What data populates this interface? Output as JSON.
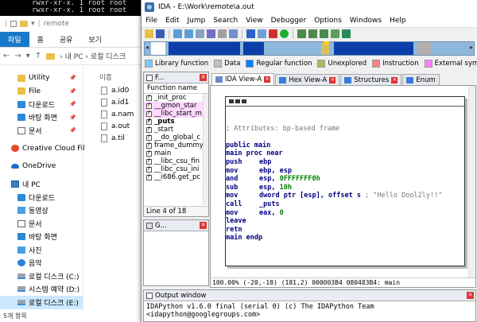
{
  "terminal": {
    "lines": [
      "rwxr-xr-x. 1 root root",
      "rwxr-xr-x. 1 root root"
    ]
  },
  "explorer": {
    "title": "remote",
    "ribbon_tabs": [
      "파일",
      "홈",
      "공유",
      "보기"
    ],
    "address": "› 내 PC › 로컬 디스크",
    "column_header": "이름",
    "nav": {
      "quick": [
        {
          "label": "Utility",
          "icon": "folder-icon"
        },
        {
          "label": "File",
          "icon": "folder-icon"
        },
        {
          "label": "다운로드",
          "icon": "download-icon"
        },
        {
          "label": "바탕 화면",
          "icon": "desktop-icon"
        },
        {
          "label": "문서",
          "icon": "document-icon"
        }
      ],
      "creative": "Creative Cloud Fil",
      "onedrive": "OneDrive",
      "this_pc": "내 PC",
      "pc_items": [
        {
          "label": "다운로드",
          "icon": "download-icon"
        },
        {
          "label": "동영상",
          "icon": "video-icon"
        },
        {
          "label": "문서",
          "icon": "document-icon"
        },
        {
          "label": "바탕 화면",
          "icon": "desktop-icon"
        },
        {
          "label": "사진",
          "icon": "picture-icon"
        },
        {
          "label": "음악",
          "icon": "music-icon"
        },
        {
          "label": "로컬 디스크 (C:)",
          "icon": "drive-icon"
        },
        {
          "label": "시스템 예약 (D:)",
          "icon": "drive-icon"
        },
        {
          "label": "로컬 디스크 (E:)",
          "icon": "drive-icon"
        }
      ]
    },
    "files": [
      "a.id0",
      "a.id1",
      "a.nam",
      "a.out",
      "a.til"
    ],
    "status": "5개 항목"
  },
  "ida": {
    "title": "IDA - E:\\Work\\remote\\a.out",
    "menus": [
      "File",
      "Edit",
      "Jump",
      "Search",
      "View",
      "Debugger",
      "Options",
      "Windows",
      "Help"
    ],
    "legend": [
      {
        "label": "Library function",
        "color": "#80c8ff"
      },
      {
        "label": "Data",
        "color": "#c0c0c0"
      },
      {
        "label": "Regular function",
        "color": "#0080ff"
      },
      {
        "label": "Unexplored",
        "color": "#b4b464"
      },
      {
        "label": "Instruction",
        "color": "#ff8080"
      },
      {
        "label": "External symbol",
        "color": "#ff80ff"
      }
    ],
    "function_pane": {
      "tab_label": "F...",
      "header": "Function name",
      "functions": [
        {
          "name": "_init_proc",
          "style": "normal"
        },
        {
          "name": "__gmon_star",
          "style": "hl"
        },
        {
          "name": "__libc_start_m",
          "style": "hl"
        },
        {
          "name": "_puts",
          "style": "bold"
        },
        {
          "name": "_start",
          "style": "normal"
        },
        {
          "name": "__do_global_c",
          "style": "normal"
        },
        {
          "name": "frame_dummy",
          "style": "normal"
        },
        {
          "name": "main",
          "style": "normal"
        },
        {
          "name": "__libc_csu_fin",
          "style": "normal"
        },
        {
          "name": "__libc_csu_ini",
          "style": "normal"
        },
        {
          "name": "__i686.get_pc",
          "style": "normal"
        }
      ],
      "status": "Line 4 of 18"
    },
    "graph_pane": {
      "tab_label": "G..."
    },
    "tabs": [
      {
        "label": "IDA View-A",
        "active": true
      },
      {
        "label": "Hex View-A",
        "active": false
      },
      {
        "label": "Structures",
        "active": false
      },
      {
        "label": "Enum",
        "active": false
      }
    ],
    "disasm": {
      "comment": "; Attributes: bp-based frame",
      "public_line": "public main",
      "proc_line": "main proc near",
      "instructions": [
        {
          "mn": "push",
          "op": "ebp",
          "num": "",
          "tail": ""
        },
        {
          "mn": "mov",
          "op": "ebp, esp",
          "num": "",
          "tail": ""
        },
        {
          "mn": "and",
          "op": "esp, ",
          "num": "0FFFFFFF0h",
          "tail": ""
        },
        {
          "mn": "sub",
          "op": "esp, ",
          "num": "10h",
          "tail": ""
        },
        {
          "mn": "mov",
          "op": "dword ptr [esp], offset s",
          "num": "",
          "tail": " ; \"Hello Dool2ly!!\""
        },
        {
          "mn": "call",
          "op": "_puts",
          "num": "",
          "tail": ""
        },
        {
          "mn": "mov",
          "op": "eax, ",
          "num": "0",
          "tail": ""
        },
        {
          "mn": "leave",
          "op": "",
          "num": "",
          "tail": ""
        },
        {
          "mn": "retn",
          "op": "",
          "num": "",
          "tail": ""
        }
      ],
      "endp_line": "main endp"
    },
    "view_status": "100.00% (-20,-18) (181,2) 000003B4 080483B4: main",
    "output": {
      "title": "Output window",
      "lines": [
        "IDAPython v1.6.0 final (serial 0) (c) The IDAPython Team",
        "<idapython@googlegroups.com>"
      ]
    }
  }
}
